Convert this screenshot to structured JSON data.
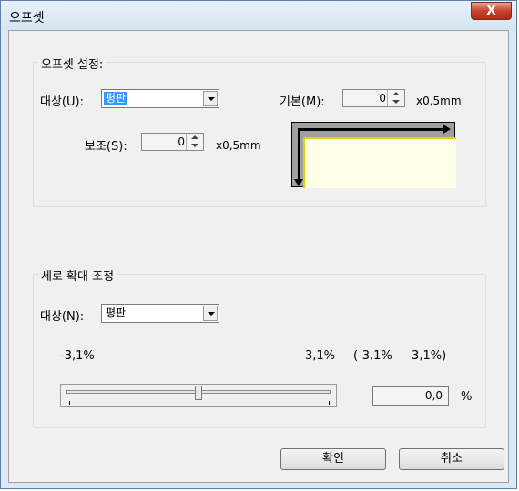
{
  "window": {
    "title": "오프셋",
    "close_label": "X"
  },
  "offset_group": {
    "title": "오프셋 설정:",
    "target_label": "대상(U):",
    "target_value": "평판",
    "basic_label": "기본(M):",
    "basic_value": "0",
    "basic_unit": "x0,5mm",
    "sub_label": "보조(S):",
    "sub_value": "0",
    "sub_unit": "x0,5mm"
  },
  "stretch_group": {
    "title": "세로 확대 조정",
    "target_label": "대상(N):",
    "target_value": "평판",
    "min_label": "-3,1%",
    "max_label": "3,1%",
    "range_label": "(-3,1% — 3,1%)",
    "value": "0,0",
    "unit": "%",
    "slider_fraction": 0.5
  },
  "buttons": {
    "ok": "확인",
    "cancel": "취소"
  }
}
